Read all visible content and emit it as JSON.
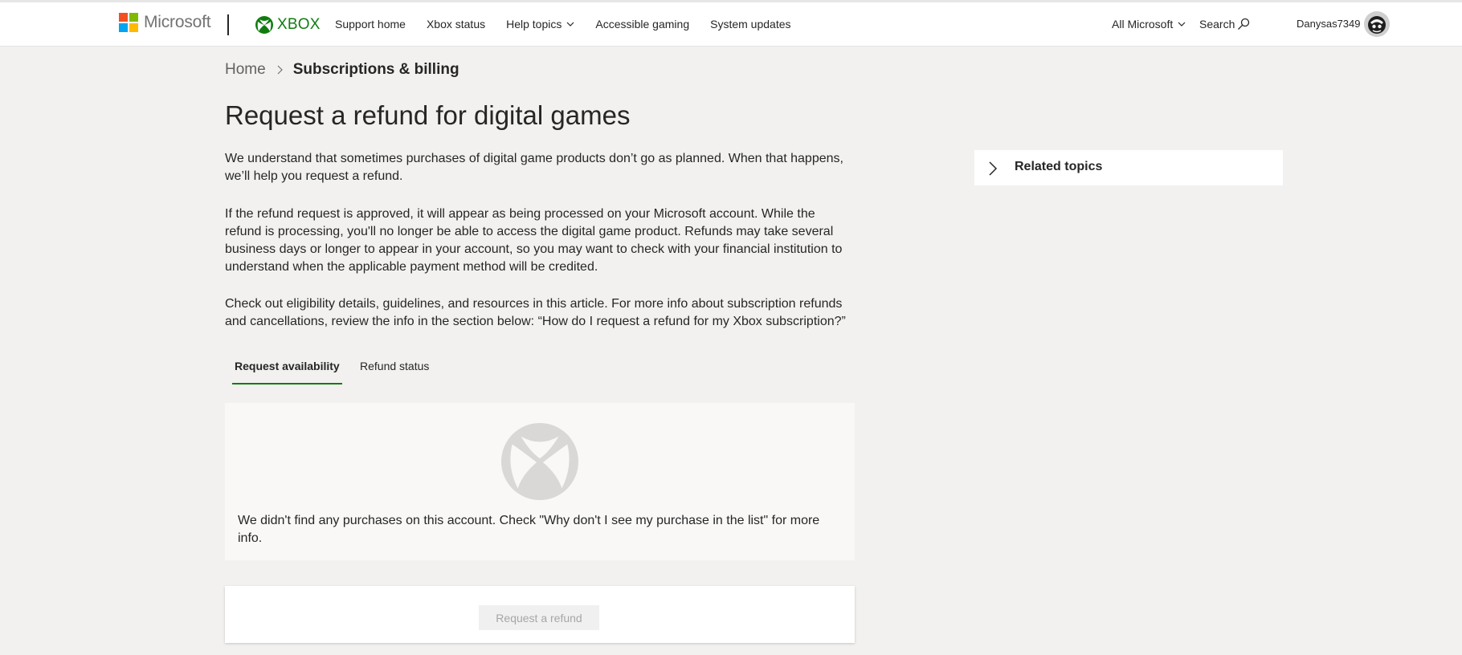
{
  "header": {
    "microsoft_label": "Microsoft",
    "xbox_label": "XBOX",
    "nav": [
      "Support home",
      "Xbox status",
      "Help topics",
      "Accessible gaming",
      "System updates"
    ],
    "all_microsoft": "All Microsoft",
    "search": "Search",
    "username": "Danysas7349"
  },
  "breadcrumb": {
    "home": "Home",
    "current": "Subscriptions & billing"
  },
  "article": {
    "title": "Request a refund for digital games",
    "paragraphs": [
      "We understand that sometimes purchases of digital game products don’t go as planned. When that happens, we’ll help you request a refund.",
      "If the refund request is approved, it will appear as being processed on your Microsoft account. While the refund is processing, you'll no longer be able to access the digital game product. Refunds may take several business days or longer to appear in your account, so you may want to check with your financial institution to understand when the applicable payment method will be credited.",
      "Check out eligibility details, guidelines, and resources in this article. For more info about subscription refunds and cancellations, review the info in the section below: “How do I request a refund for my Xbox subscription?”"
    ]
  },
  "tabs": {
    "active": "Request availability",
    "inactive": "Refund status"
  },
  "empty_state": {
    "icon": "xbox-logo-icon",
    "message": "We didn't find any purchases on this account. Check \"Why don't I see my purchase in the list\" for more info."
  },
  "action": {
    "button_label": "Request a refund"
  },
  "sidebar": {
    "related_topics": "Related topics"
  },
  "colors": {
    "xbox_green": "#107c10",
    "page_bg": "#f2f1ef"
  }
}
